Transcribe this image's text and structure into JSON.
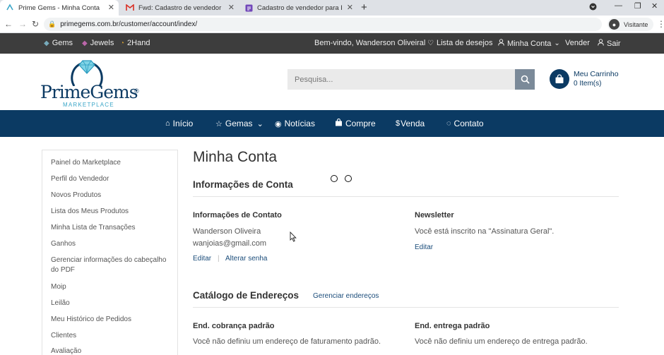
{
  "browser": {
    "tabs": [
      {
        "title": "Prime Gems - Minha Conta",
        "icon": "primegems-favicon"
      },
      {
        "title": "Fwd: Cadastro de vendedor para Prim",
        "icon": "gmail-icon"
      },
      {
        "title": "Cadastro de vendedor para Prime",
        "icon": "form-icon"
      }
    ],
    "url": "primegems.com.br/customer/account/index/",
    "profile_label": "Visitante"
  },
  "topbar": {
    "left": [
      "Gems",
      "Jewels",
      "2Hand"
    ],
    "welcome": "Bem-vindo, Wanderson Oliveiral",
    "wishlist": "Lista de desejos",
    "account": "Minha Conta",
    "sell": "Vender",
    "logout": "Sair"
  },
  "header": {
    "logo_word": "PrimeGems",
    "logo_reg": "®",
    "logo_sub": "MARKETPLACE",
    "search_placeholder": "Pesquisa...",
    "cart_title": "Meu Carrinho",
    "cart_count": "0 Item(s)"
  },
  "nav": [
    "Início",
    "Gemas",
    "Notícias",
    "Compre",
    "Venda",
    "Contato"
  ],
  "sidebar": [
    "Painel do Marketplace",
    "Perfil do Vendedor",
    "Novos Produtos",
    "Lista dos Meus Produtos",
    "Minha Lista de Transações",
    "Ganhos",
    "Gerenciar informações do cabeçalho do PDF",
    "Moip",
    "Leilão",
    "Meu Histórico de Pedidos",
    "Clientes",
    "Avaliação"
  ],
  "content": {
    "title": "Minha Conta",
    "account_info": "Informações de Conta",
    "contact_label": "Informações de Contato",
    "contact_name": "Wanderson Oliveira",
    "contact_email": "wanjoias@gmail.com",
    "edit": "Editar",
    "change_password": "Alterar senha",
    "newsletter_label": "Newsletter",
    "newsletter_text": "Você está inscrito na \"Assinatura Geral\".",
    "newsletter_edit": "Editar",
    "address_book": "Catálogo de Endereços",
    "manage_addresses": "Gerenciar endereços",
    "billing_label": "End. cobrança padrão",
    "billing_text": "Você não definiu um endereço de faturamento padrão.",
    "shipping_label": "End. entrega padrão",
    "shipping_text": "Você não definiu um endereço de entrega padrão."
  },
  "colors": {
    "brand": "#0b3a63",
    "topbar": "#3d3d3d",
    "accent": "#3aa6c8"
  }
}
